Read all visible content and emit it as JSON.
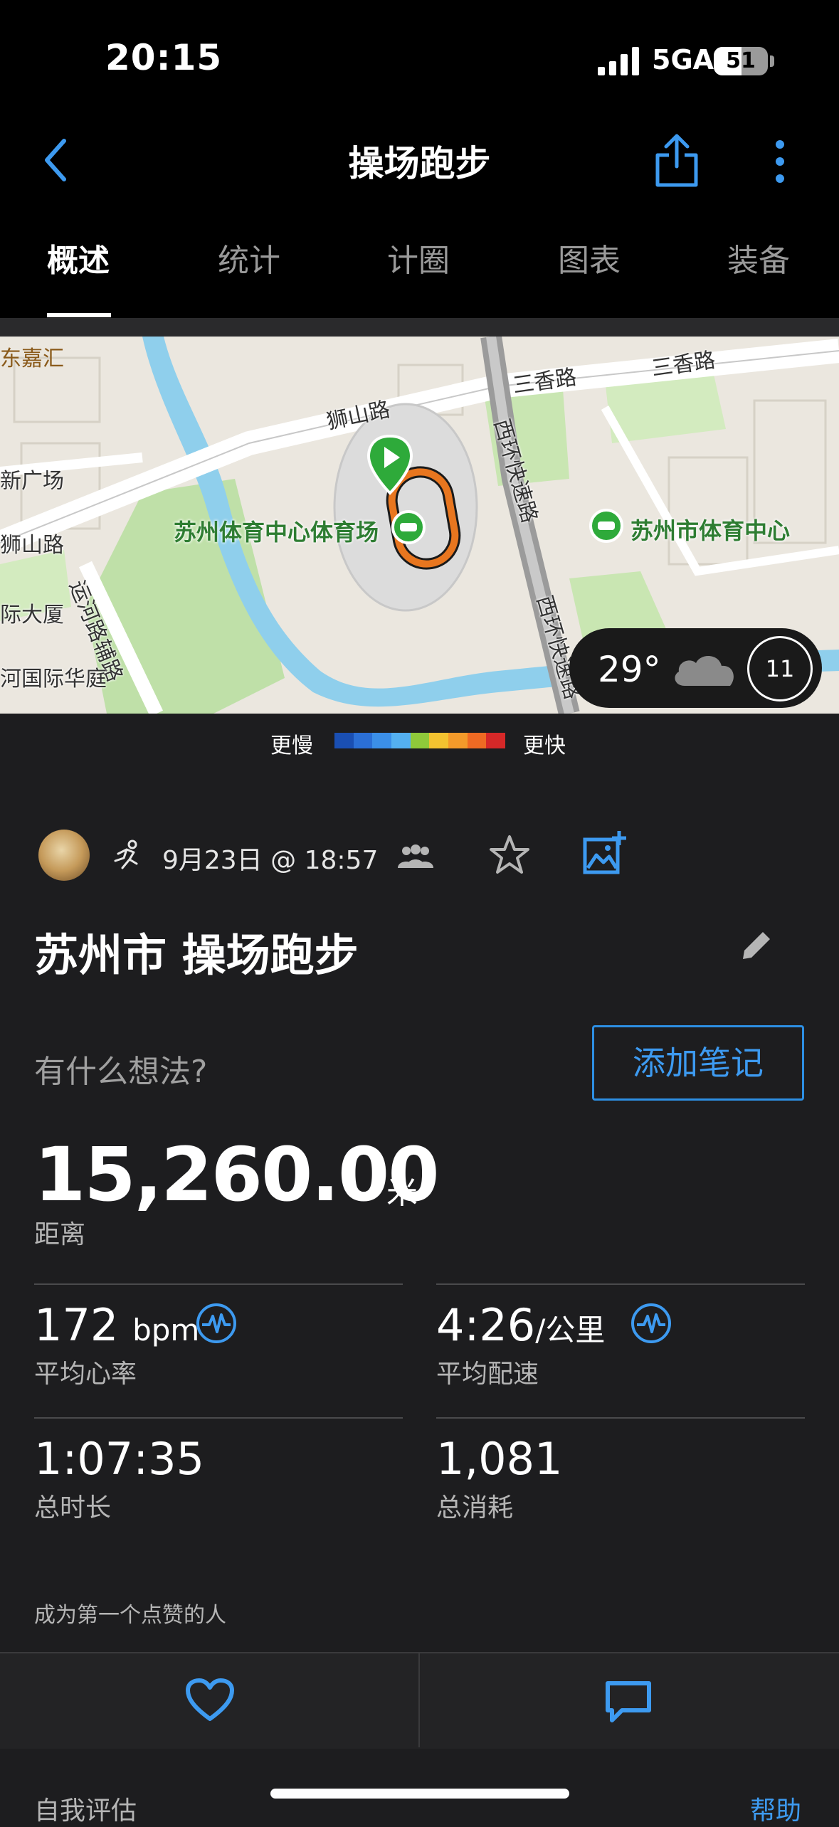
{
  "status_bar": {
    "time": "20:15",
    "network": "5GA",
    "battery": "51",
    "battery_level": 0.51
  },
  "nav": {
    "title": "操场跑步"
  },
  "tabs": [
    {
      "label": "概述",
      "active": true
    },
    {
      "label": "统计",
      "active": false
    },
    {
      "label": "计圈",
      "active": false
    },
    {
      "label": "图表",
      "active": false
    },
    {
      "label": "装备",
      "active": false
    }
  ],
  "map": {
    "labels": {
      "east_jiahui": "东嘉汇",
      "xin_plaza": "新广场",
      "shishan_road_1": "狮山路",
      "shishan_road_2": "狮山路",
      "yunhe_fu_road": "运河路辅路",
      "intl_building": "际大厦",
      "canal_court": "河国际华庭",
      "sanxiang_road_1": "三香路",
      "sanxiang_road_2": "三香路",
      "xihuan_expressway_1": "西环快速路",
      "xihuan_expressway_2": "西环快速路",
      "stadium": "苏州体育中心体育场",
      "sports_center": "苏州市体育中心"
    },
    "weather": {
      "temperature": "29°",
      "wind": "11"
    }
  },
  "legend": {
    "slower": "更慢",
    "faster": "更快",
    "colors": [
      "#1a4fb3",
      "#2b6fd6",
      "#3b8fe8",
      "#54b0f0",
      "#8fc93a",
      "#f2c230",
      "#f39a2a",
      "#ef6a23",
      "#d62828"
    ]
  },
  "activity": {
    "datetime": "9月23日 @ 18:57",
    "name": "苏州市 操场跑步",
    "thoughts_placeholder": "有什么想法?",
    "add_note": "添加笔记"
  },
  "distance": {
    "value": "15,260.00",
    "unit": "米",
    "label": "距离"
  },
  "stats": {
    "avg_hr": {
      "value": "172",
      "unit": "bpm",
      "label": "平均心率"
    },
    "avg_pace": {
      "value": "4:26",
      "unit": "/公里",
      "label": "平均配速"
    },
    "duration": {
      "value": "1:07:35",
      "label": "总时长"
    },
    "calories": {
      "value": "1,081",
      "label": "总消耗"
    }
  },
  "social": {
    "likes_prompt": "成为第一个点赞的人"
  },
  "footer": {
    "self_eval": "自我评估",
    "help": "帮助"
  },
  "colors": {
    "accent": "#3d9af0",
    "background": "#1d1d1f",
    "route": "#e8761f",
    "start_marker": "#2eaa3a"
  }
}
